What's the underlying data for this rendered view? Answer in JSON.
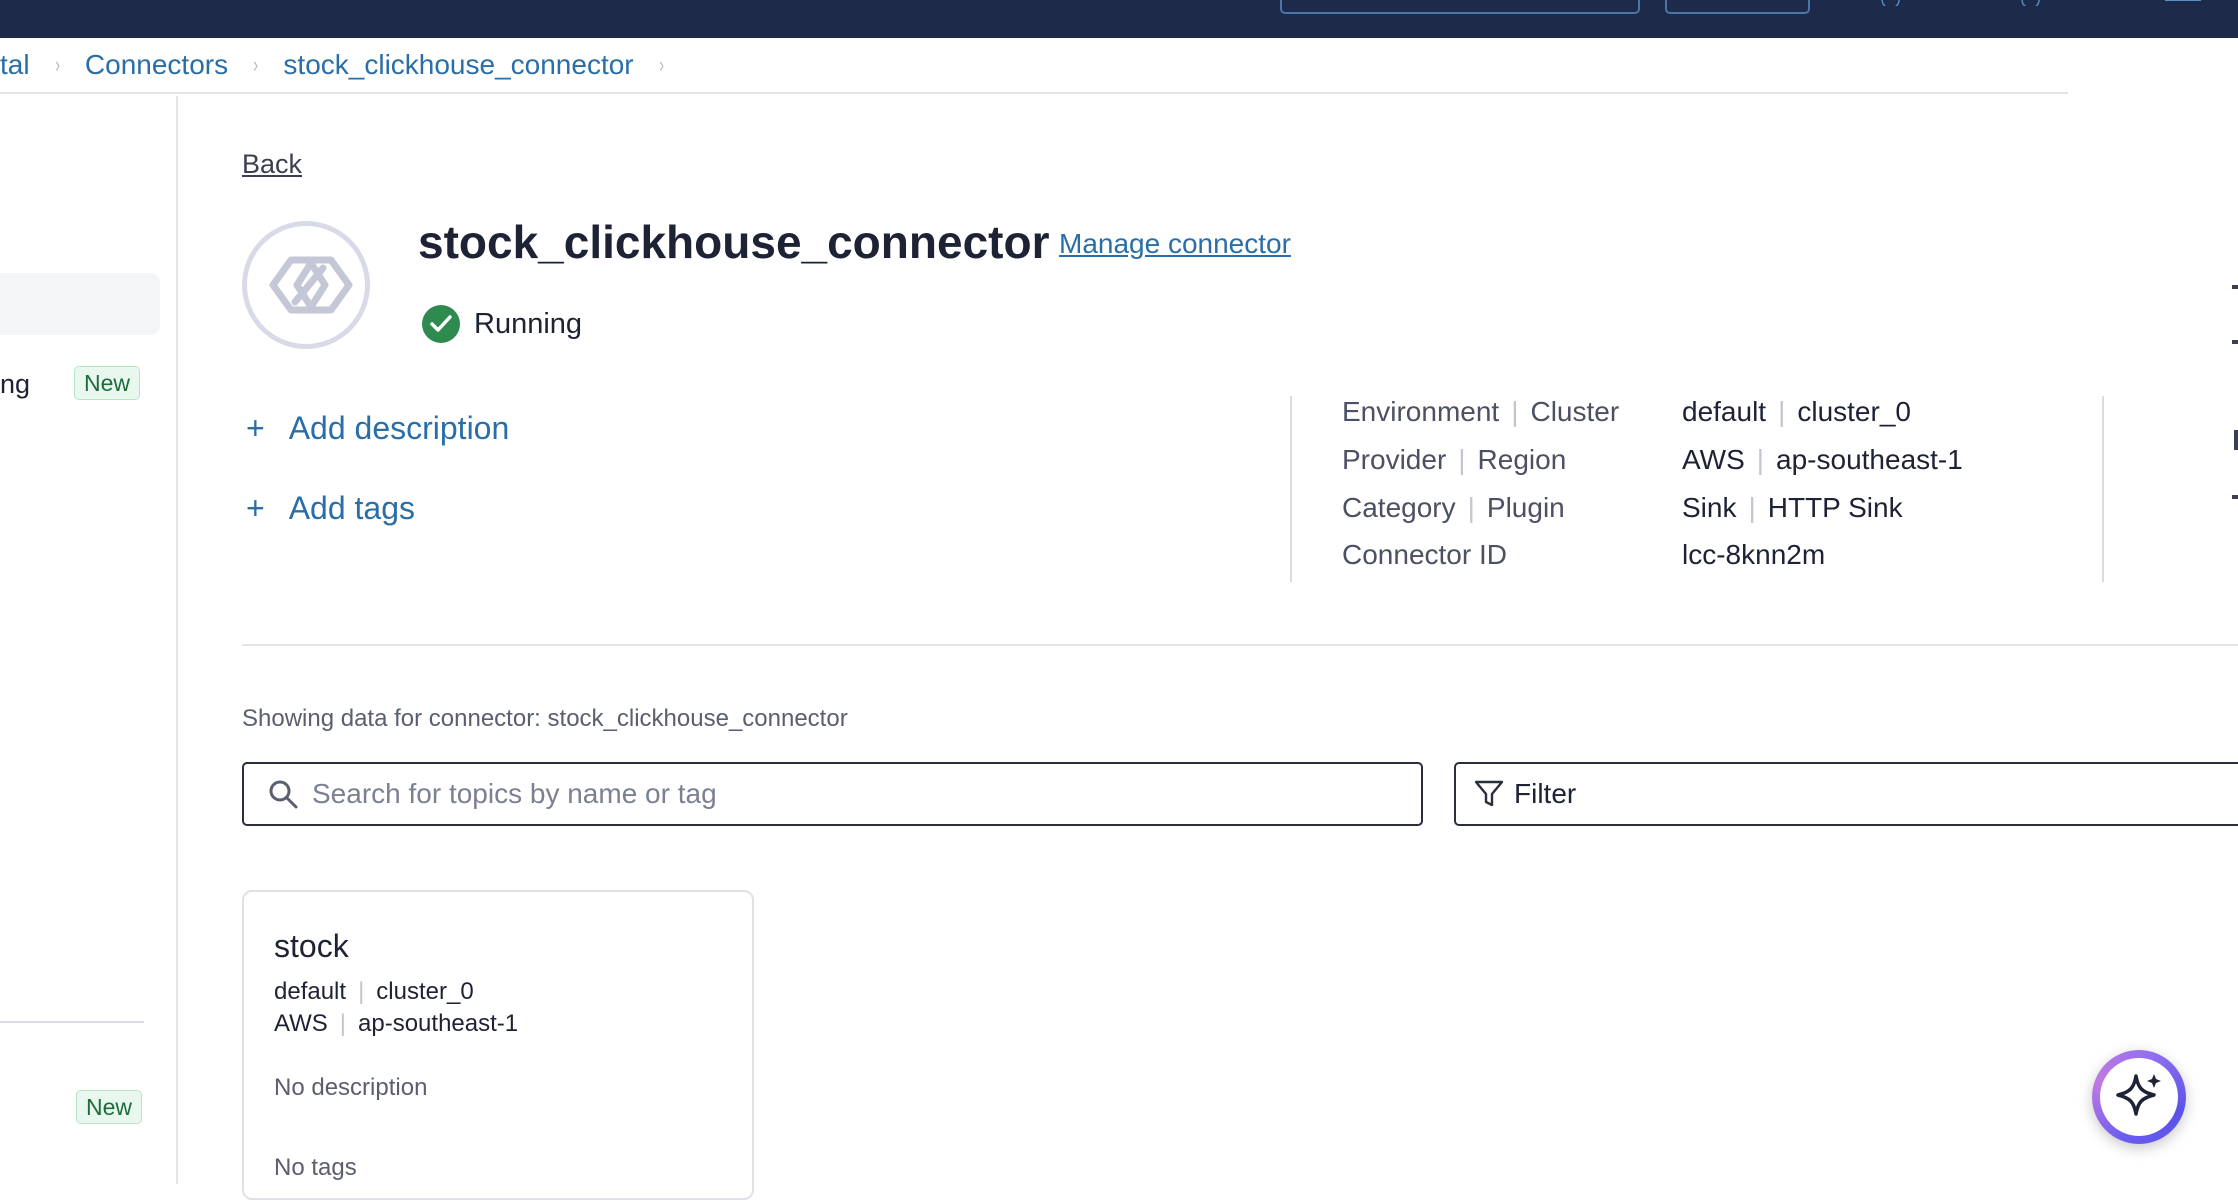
{
  "topbar": {
    "background": "#1e2a4a"
  },
  "breadcrumb": {
    "items": [
      "tal",
      "Connectors",
      "stock_clickhouse_connector"
    ],
    "separator": "›"
  },
  "sidebar": {
    "items": [
      {
        "label": "ng",
        "badge": "New"
      },
      {
        "label": "",
        "badge": "New"
      }
    ]
  },
  "back_label": "Back",
  "connector": {
    "name": "stock_clickhouse_connector",
    "manage_label": "Manage connector",
    "status": "Running",
    "status_color": "#2f8a4f",
    "add_description_label": "Add description",
    "add_tags_label": "Add tags"
  },
  "metadata": {
    "rows": [
      {
        "key_a": "Environment",
        "key_b": "Cluster",
        "val_a": "default",
        "val_b": "cluster_0"
      },
      {
        "key_a": "Provider",
        "key_b": "Region",
        "val_a": "AWS",
        "val_b": "ap-southeast-1"
      },
      {
        "key_a": "Category",
        "key_b": "Plugin",
        "val_a": "Sink",
        "val_b": "HTTP Sink"
      },
      {
        "key_a": "Connector ID",
        "val_a": "lcc-8knn2m"
      }
    ]
  },
  "topics_section": {
    "showing_text": "Showing data for connector: stock_clickhouse_connector",
    "search_placeholder": "Search for topics by name or tag",
    "filter_label": "Filter"
  },
  "topics": [
    {
      "name": "stock",
      "environment": "default",
      "cluster": "cluster_0",
      "provider": "AWS",
      "region": "ap-southeast-1",
      "description": "No description",
      "tags": "No tags"
    }
  ],
  "colors": {
    "link": "#2a6ea8",
    "badge_bg": "#e9f8ee",
    "badge_text": "#1e6b3b"
  }
}
